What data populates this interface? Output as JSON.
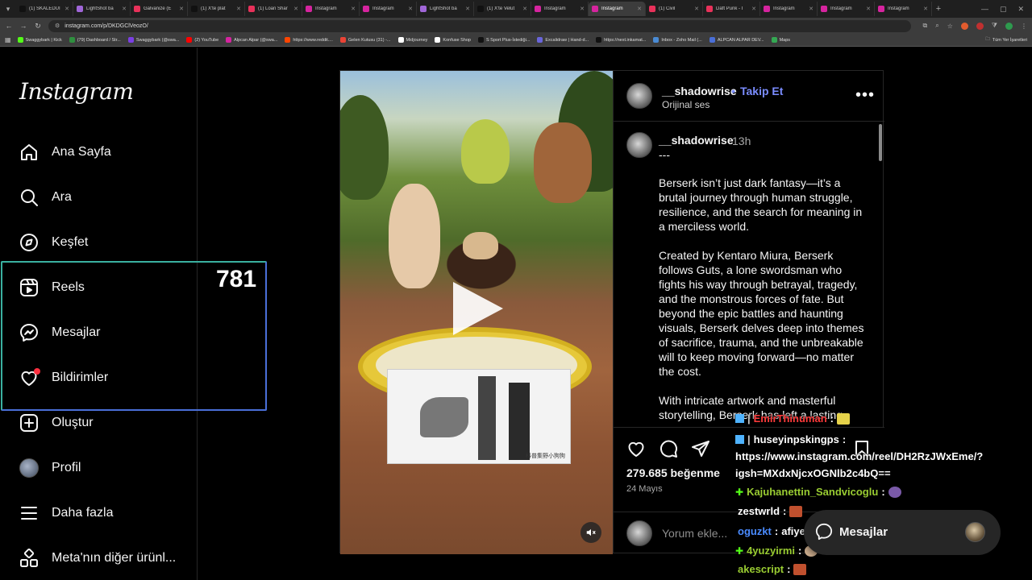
{
  "browser": {
    "tabs": [
      {
        "label": "(1) SKALEDUI",
        "color": "#111111"
      },
      {
        "label": "LightShot ba",
        "color": "#a066d8"
      },
      {
        "label": "Galvanize (E",
        "color": "#e8315a"
      },
      {
        "label": "(1) X'te plat",
        "color": "#111111"
      },
      {
        "label": "(1) Loan Shar",
        "color": "#e8315a"
      },
      {
        "label": "Instagram",
        "color": "#d6249f"
      },
      {
        "label": "Instagram",
        "color": "#d6249f"
      },
      {
        "label": "LightShot ba",
        "color": "#a066d8"
      },
      {
        "label": "(1) X'te Velut",
        "color": "#111111"
      },
      {
        "label": "Instagram",
        "color": "#d6249f"
      },
      {
        "label": "Instagram",
        "color": "#d6249f"
      },
      {
        "label": "(1) Civil",
        "color": "#e8315a"
      },
      {
        "label": "Daft Punk - I",
        "color": "#e8315a"
      },
      {
        "label": "Instagram",
        "color": "#d6249f"
      },
      {
        "label": "Instagram",
        "color": "#d6249f"
      },
      {
        "label": "Instagram",
        "color": "#d6249f"
      }
    ],
    "active_tab_index": 10,
    "new_tab_label": "+",
    "url": "instagram.com/p/DKDGClVeozO/",
    "bookmarks": [
      {
        "label": "Swaggybark | Kick",
        "color": "#53fc18"
      },
      {
        "label": "(79) Dashboard / Str...",
        "color": "#2f8f3f"
      },
      {
        "label": "Swaggybark (@swa...",
        "color": "#7b3fe4"
      },
      {
        "label": "(2) YouTube",
        "color": "#ff0000"
      },
      {
        "label": "Alpcan Alpar (@swa...",
        "color": "#d6249f"
      },
      {
        "label": "https://www.reddit....",
        "color": "#ff4500"
      },
      {
        "label": "Gelen Kutusu (31) -...",
        "color": "#ea4335"
      },
      {
        "label": "Midjourney",
        "color": "#ffffff"
      },
      {
        "label": "Konfuse Shop",
        "color": "#ffffff"
      },
      {
        "label": "S Sport Plus-İstediği...",
        "color": "#111111"
      },
      {
        "label": "Excalidraw | Hand-d...",
        "color": "#6965db"
      },
      {
        "label": "https://next.inkamat...",
        "color": "#111111"
      },
      {
        "label": "Inbox - Zoho Mail (...",
        "color": "#4a8bd4"
      },
      {
        "label": "ALPCAN ALPAR DEV...",
        "color": "#4a6fd8"
      },
      {
        "label": "Maps",
        "color": "#34a853"
      }
    ],
    "all_bookmarks_label": "Tüm Yer İşaretleri"
  },
  "sidebar": {
    "logo": "Instagram",
    "items": [
      {
        "label": "Ana Sayfa",
        "icon": "home-icon"
      },
      {
        "label": "Ara",
        "icon": "search-icon"
      },
      {
        "label": "Keşfet",
        "icon": "compass-icon"
      },
      {
        "label": "Reels",
        "icon": "reels-icon"
      },
      {
        "label": "Mesajlar",
        "icon": "messenger-icon"
      },
      {
        "label": "Bildirimler",
        "icon": "heart-icon"
      },
      {
        "label": "Oluştur",
        "icon": "plus-square-icon"
      },
      {
        "label": "Profil",
        "icon": "avatar"
      },
      {
        "label": "Daha fazla",
        "icon": "menu-icon"
      },
      {
        "label": "Meta'nın diğer ürünl...",
        "icon": "meta-apps-icon"
      }
    ]
  },
  "overlay": {
    "count": "781"
  },
  "post": {
    "username": "__shadowrise",
    "follow_sep": "•",
    "follow_label": "Takip Et",
    "audio": "Orijinal ses",
    "time": "13h",
    "caption_lead": "---",
    "caption_paragraphs": [
      "Berserk isn’t just dark fantasy—it’s a brutal journey through human struggle, resilience, and the search for meaning in a merciless world.",
      "Created by Kentaro Miura, Berserk follows Guts, a lone swordsman who fights his way through betrayal, tragedy, and the monstrous forces of fate. But beyond the epic battles and haunting visuals, Berserk delves deep into themes of sacrifice, trauma, and the unbreakable will to keep moving forward—no matter the cost.",
      "With intricate artwork and masterful storytelling, Berserk has left a lasting"
    ],
    "likes": "279.685 beğenme",
    "date": "24 Mayıs",
    "comment_placeholder": "Yorum ekle...",
    "media_caption": "科普集野小狗狗"
  },
  "chat": [
    {
      "name": "EmirThinuman",
      "sep": ":",
      "msg": "",
      "color": "#ff3b3b",
      "badge": "#4fb3ff"
    },
    {
      "name": "huseyinpskingps",
      "sep": ":",
      "msg": "",
      "color": "#ffffff",
      "badge": "#4fb3ff"
    },
    {
      "name": "",
      "sep": "",
      "msg": "https://www.instagram.com/reel/DH2RzJWxEme/?",
      "color": "#ffffff",
      "badge": ""
    },
    {
      "name": "",
      "sep": "",
      "msg": "igsh=MXdxNjcxOGNlb2c4bQ==",
      "color": "#ffffff",
      "badge": ""
    },
    {
      "name": "Kajuhanettin_Sandvicoglu",
      "sep": ":",
      "msg": "",
      "color": "#9acd32",
      "badge": "#53fc18"
    },
    {
      "name": "zestwrld",
      "sep": ":",
      "msg": "",
      "color": "#ffffff",
      "badge": ""
    },
    {
      "name": "oguzkt",
      "sep": ":",
      "msg": "afiyet olsun day",
      "color": "#4a8bff",
      "badge": ""
    },
    {
      "name": "4yuzyirmi",
      "sep": ":",
      "msg": "",
      "color": "#9acd32",
      "badge": "#53fc18"
    },
    {
      "name": "akescript",
      "sep": ":",
      "msg": "",
      "color": "#9acd32",
      "badge": ""
    }
  ],
  "messages_pill": {
    "label": "Mesajlar"
  },
  "colors": {
    "accent": "#7a8cff",
    "notification": "#ff3040",
    "overlay_border_top": "#3ab0a0",
    "overlay_border_bottom": "#4a6fd8"
  }
}
